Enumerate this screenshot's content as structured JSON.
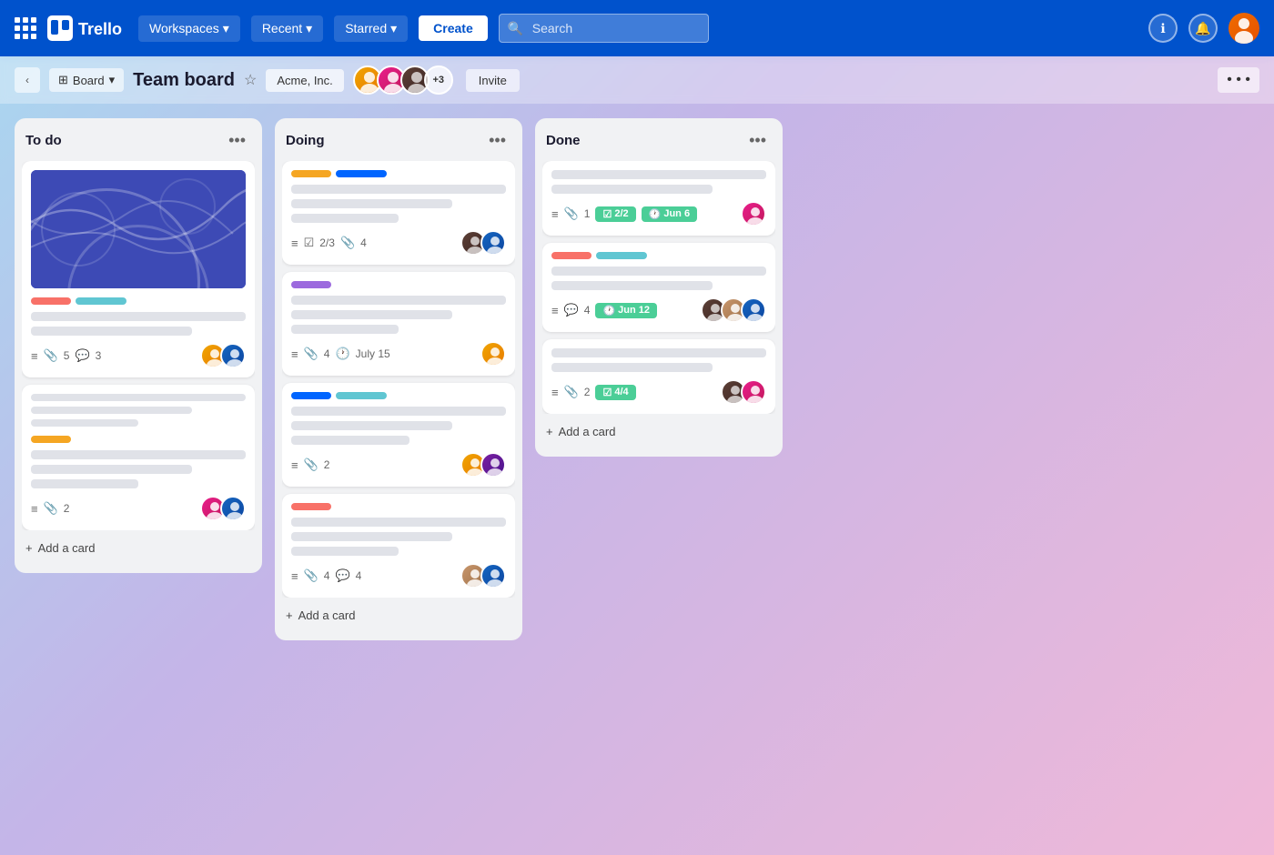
{
  "navbar": {
    "logo_text": "Trello",
    "workspaces_label": "Workspaces",
    "recent_label": "Recent",
    "starred_label": "Starred",
    "create_label": "Create",
    "search_placeholder": "Search",
    "info_icon": "ℹ",
    "bell_icon": "🔔"
  },
  "board_header": {
    "view_label": "Board",
    "board_title": "Team board",
    "workspace_label": "Acme, Inc.",
    "member_count_extra": "+3",
    "invite_label": "Invite",
    "more_icon": "•••"
  },
  "columns": [
    {
      "id": "todo",
      "title": "To do",
      "cards": [
        {
          "id": "card-1",
          "has_cover": true,
          "labels": [
            "pink",
            "cyan"
          ],
          "lines": [
            "full",
            "3q",
            "half"
          ],
          "footer": {
            "list_icon": true,
            "attach": 5,
            "comment": 3,
            "members": [
              "yellow-av",
              "blue-av"
            ]
          }
        },
        {
          "id": "card-2",
          "has_cover": false,
          "labels": [
            "yellow"
          ],
          "lines": [
            "full",
            "3q",
            "half"
          ],
          "footer": {
            "list_icon": true,
            "attach": 2,
            "comment": null,
            "members": [
              "pink-av",
              "blue-av"
            ]
          }
        }
      ],
      "add_label": "+ Add a card"
    },
    {
      "id": "doing",
      "title": "Doing",
      "cards": [
        {
          "id": "card-3",
          "has_cover": false,
          "labels": [
            "yellow-lg",
            "blue-chip"
          ],
          "lines": [
            "full",
            "3q",
            "half"
          ],
          "footer": {
            "list_icon": true,
            "check": "2/3",
            "attach": 4,
            "date": null,
            "members": [
              "dark-av",
              "blue-av"
            ]
          }
        },
        {
          "id": "card-4",
          "has_cover": false,
          "labels": [
            "purple"
          ],
          "lines": [
            "full",
            "3q",
            "half"
          ],
          "footer": {
            "list_icon": true,
            "attach": 4,
            "date": "July 15",
            "members": [
              "yellow-av2"
            ]
          }
        },
        {
          "id": "card-5",
          "has_cover": false,
          "labels": [
            "blue-lg",
            "cyan-chip"
          ],
          "lines": [
            "full",
            "3q",
            "half"
          ],
          "footer": {
            "list_icon": true,
            "attach": 2,
            "date": null,
            "members": [
              "yellow-av3",
              "purple-av"
            ]
          }
        },
        {
          "id": "card-6",
          "has_cover": false,
          "labels": [
            "pink"
          ],
          "lines": [
            "full",
            "3q",
            "half"
          ],
          "footer": {
            "list_icon": true,
            "attach": 4,
            "comment": 4,
            "members": [
              "skin-av",
              "blue-av2"
            ]
          }
        }
      ],
      "add_label": "+ Add a card"
    },
    {
      "id": "done",
      "title": "Done",
      "cards": [
        {
          "id": "card-7",
          "has_cover": false,
          "labels": [],
          "lines": [
            "full",
            "3q"
          ],
          "footer": {
            "list_icon": true,
            "attach": 1,
            "check_badge": "2/2",
            "date_badge": "Jun 6",
            "members": [
              "pink-av2"
            ]
          }
        },
        {
          "id": "card-8",
          "has_cover": false,
          "labels": [
            "pink",
            "cyan"
          ],
          "lines": [
            "full",
            "3q"
          ],
          "footer": {
            "list_icon": true,
            "comment": 4,
            "date_badge": "Jun 12",
            "members": [
              "dark-av2",
              "skin-av2",
              "blue-av3"
            ]
          }
        },
        {
          "id": "card-9",
          "has_cover": false,
          "labels": [],
          "lines": [
            "full",
            "3q"
          ],
          "footer": {
            "list_icon": true,
            "attach": 2,
            "check_badge": "4/4",
            "members": [
              "dark-av3",
              "pink-av3"
            ]
          }
        }
      ],
      "add_label": "+ Add a card"
    }
  ]
}
